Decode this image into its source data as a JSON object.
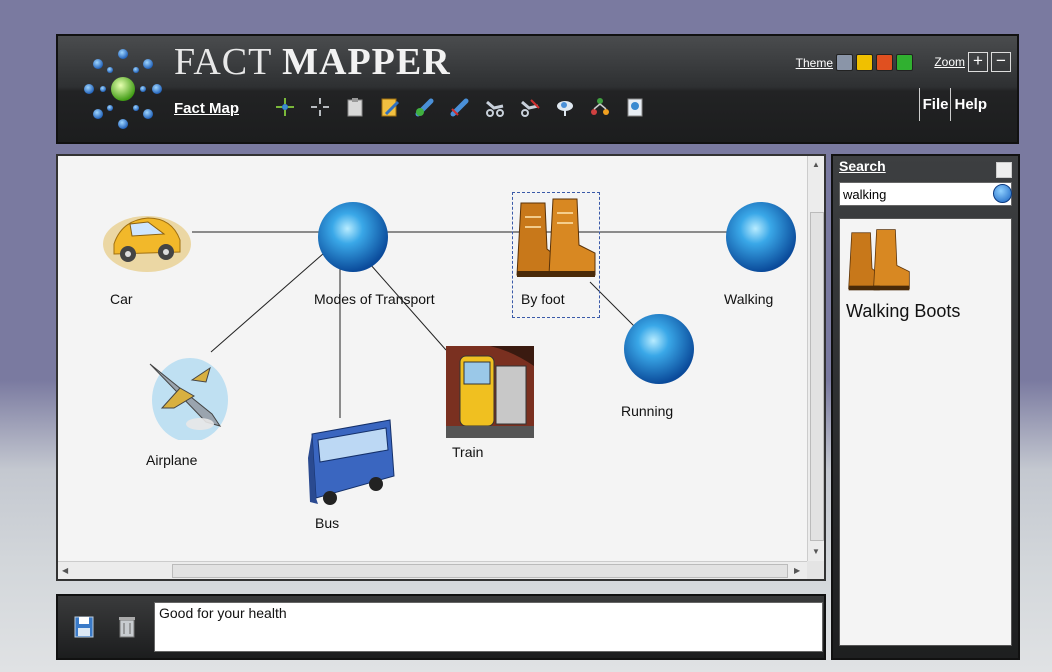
{
  "app": {
    "title_part1": "FACT",
    "title_part2": "MAPPER",
    "section_label": "Fact Map"
  },
  "toolbar": {
    "tools": [
      "add-node-icon",
      "magic-wand-icon",
      "clipboard-icon",
      "edit-note-icon",
      "add-link-icon",
      "remove-link-icon",
      "connect-icon",
      "disconnect-icon",
      "ideas-cloud-icon",
      "hierarchy-icon",
      "document-icon"
    ]
  },
  "header": {
    "theme_label": "Theme",
    "theme_colors": [
      "#8a95a8",
      "#f0c000",
      "#e05020",
      "#30b030"
    ],
    "zoom_label": "Zoom",
    "zoom_in": "+",
    "zoom_out": "−",
    "menu": {
      "file": "File",
      "help": "Help"
    }
  },
  "map": {
    "nodes": [
      {
        "id": "car",
        "label": "Car",
        "icon": "car-icon"
      },
      {
        "id": "transport",
        "label": "Modes of Transport",
        "icon": "blue-sphere-icon"
      },
      {
        "id": "byfoot",
        "label": "By foot",
        "icon": "boots-icon",
        "selected": true
      },
      {
        "id": "walking",
        "label": "Walking",
        "icon": "blue-sphere-icon"
      },
      {
        "id": "airplane",
        "label": "Airplane",
        "icon": "airplane-icon"
      },
      {
        "id": "bus",
        "label": "Bus",
        "icon": "bus-icon"
      },
      {
        "id": "train",
        "label": "Train",
        "icon": "train-icon"
      },
      {
        "id": "running",
        "label": "Running",
        "icon": "blue-sphere-icon"
      }
    ],
    "edges": [
      [
        "car",
        "transport"
      ],
      [
        "transport",
        "byfoot"
      ],
      [
        "byfoot",
        "walking"
      ],
      [
        "transport",
        "airplane"
      ],
      [
        "transport",
        "bus"
      ],
      [
        "transport",
        "train"
      ],
      [
        "byfoot",
        "running"
      ]
    ]
  },
  "note": {
    "text": "Good for your health"
  },
  "search": {
    "title": "Search",
    "query": "walking",
    "results": [
      {
        "label": "Walking Boots",
        "icon": "boots-icon"
      }
    ]
  }
}
